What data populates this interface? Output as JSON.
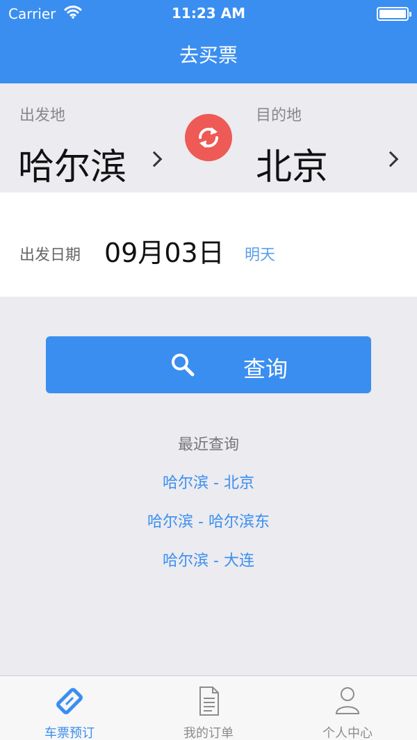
{
  "status_bar": {
    "carrier": "Carrier",
    "time": "11:23 AM"
  },
  "nav": {
    "title": "去买票"
  },
  "route": {
    "from_label": "出发地",
    "from_city": "哈尔滨",
    "to_label": "目的地",
    "to_city": "北京"
  },
  "date": {
    "label": "出发日期",
    "value": "09月03日",
    "hint": "明天"
  },
  "search": {
    "label": "查询"
  },
  "recent": {
    "title": "最近查询",
    "items": [
      "哈尔滨 - 北京",
      "哈尔滨 - 哈尔滨东",
      "哈尔滨 - 大连"
    ]
  },
  "tabs": [
    {
      "label": "车票预订",
      "icon": "ticket-icon",
      "active": true
    },
    {
      "label": "我的订单",
      "icon": "document-icon",
      "active": false
    },
    {
      "label": "个人中心",
      "icon": "person-icon",
      "active": false
    }
  ],
  "colors": {
    "primary": "#3a8ef0",
    "swap": "#ee5a55",
    "background": "#ebebf0"
  }
}
